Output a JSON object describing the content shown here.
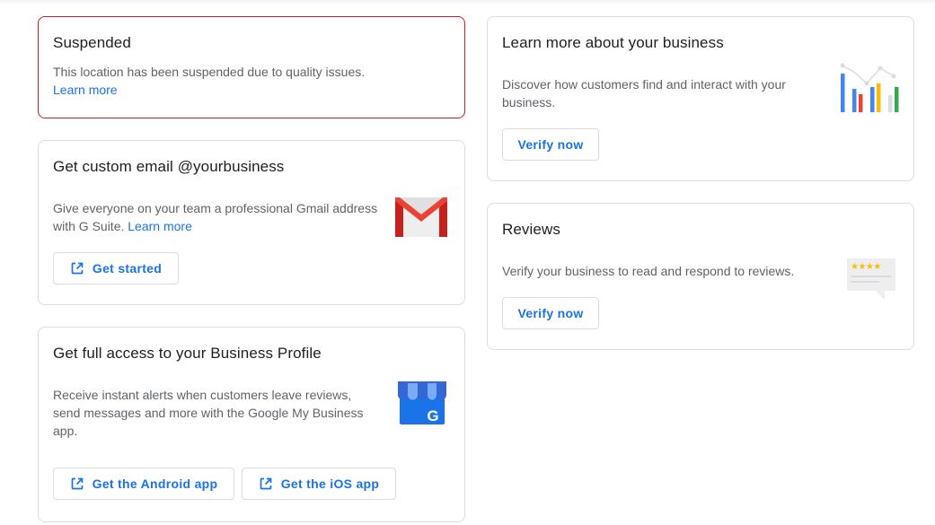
{
  "suspended": {
    "title": "Suspended",
    "text": "This location has been suspended due to quality issues.",
    "link": "Learn more"
  },
  "email": {
    "title": "Get custom email @yourbusiness",
    "text": "Give everyone on your team a professional Gmail address with G Suite.",
    "link": "Learn more",
    "button": "Get started",
    "icon": "gmail-logo-icon"
  },
  "app": {
    "title": "Get full access to your Business Profile",
    "text": "Receive instant alerts when customers leave reviews, send messages and more with the Google My Business app.",
    "android_button": "Get the Android app",
    "ios_button": "Get the iOS app",
    "icon": "google-my-business-store-icon",
    "icon_letter": "G"
  },
  "learn": {
    "title": "Learn more about your business",
    "text": "Discover how customers find and interact with your business.",
    "button": "Verify now",
    "icon": "bar-chart-icon"
  },
  "reviews": {
    "title": "Reviews",
    "text": "Verify your business to read and respond to reviews.",
    "button": "Verify now",
    "icon": "review-stars-icon"
  },
  "colors": {
    "accent": "#1a73e8",
    "error_border": "#c5221f",
    "google_blue": "#4285f4",
    "google_red": "#ea4335",
    "google_yellow": "#fbbc04",
    "google_green": "#34a853"
  }
}
